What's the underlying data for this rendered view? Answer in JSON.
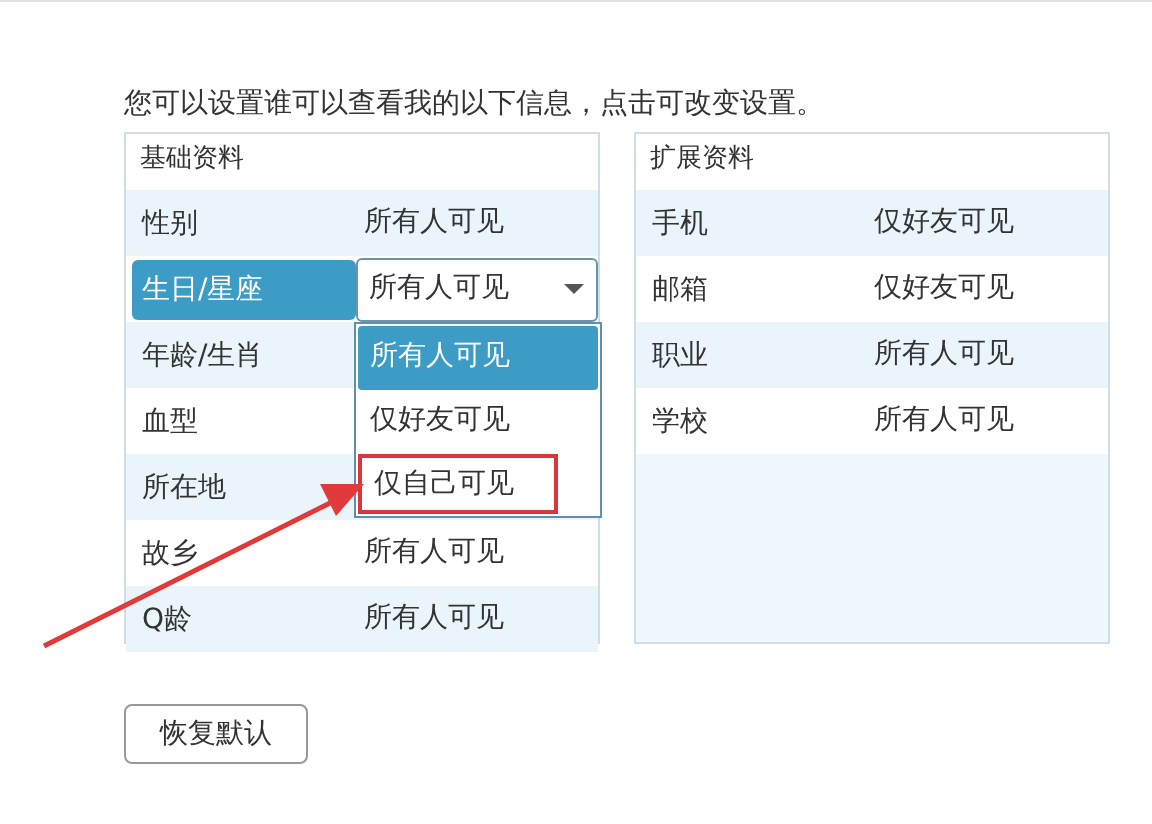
{
  "intro": "您可以设置谁可以查看我的以下信息，点击可改变设置。",
  "panels": [
    {
      "title": "基础资料",
      "rows": [
        {
          "label": "性别",
          "value": "所有人可见",
          "selected": false
        },
        {
          "label": "生日/星座",
          "selected": true,
          "dropdown": {
            "value": "所有人可见",
            "expanded": true,
            "options": [
              {
                "label": "所有人可见",
                "selected": true,
                "highlighted": false
              },
              {
                "label": "仅好友可见",
                "selected": false,
                "highlighted": false
              },
              {
                "label": "仅自己可见",
                "selected": false,
                "highlighted": true
              }
            ]
          }
        },
        {
          "label": "年龄/生肖",
          "selected": false
        },
        {
          "label": "血型",
          "selected": false
        },
        {
          "label": "所在地",
          "selected": false
        },
        {
          "label": "故乡",
          "value": "所有人可见",
          "selected": false
        },
        {
          "label": "Q龄",
          "value": "所有人可见",
          "selected": false
        }
      ]
    },
    {
      "title": "扩展资料",
      "rows": [
        {
          "label": "手机",
          "value": "仅好友可见",
          "selected": false
        },
        {
          "label": "邮箱",
          "value": "仅好友可见",
          "selected": false
        },
        {
          "label": "职业",
          "value": "所有人可见",
          "selected": false
        },
        {
          "label": "学校",
          "value": "所有人可见",
          "selected": false
        }
      ]
    }
  ],
  "reset_button": "恢复默认"
}
